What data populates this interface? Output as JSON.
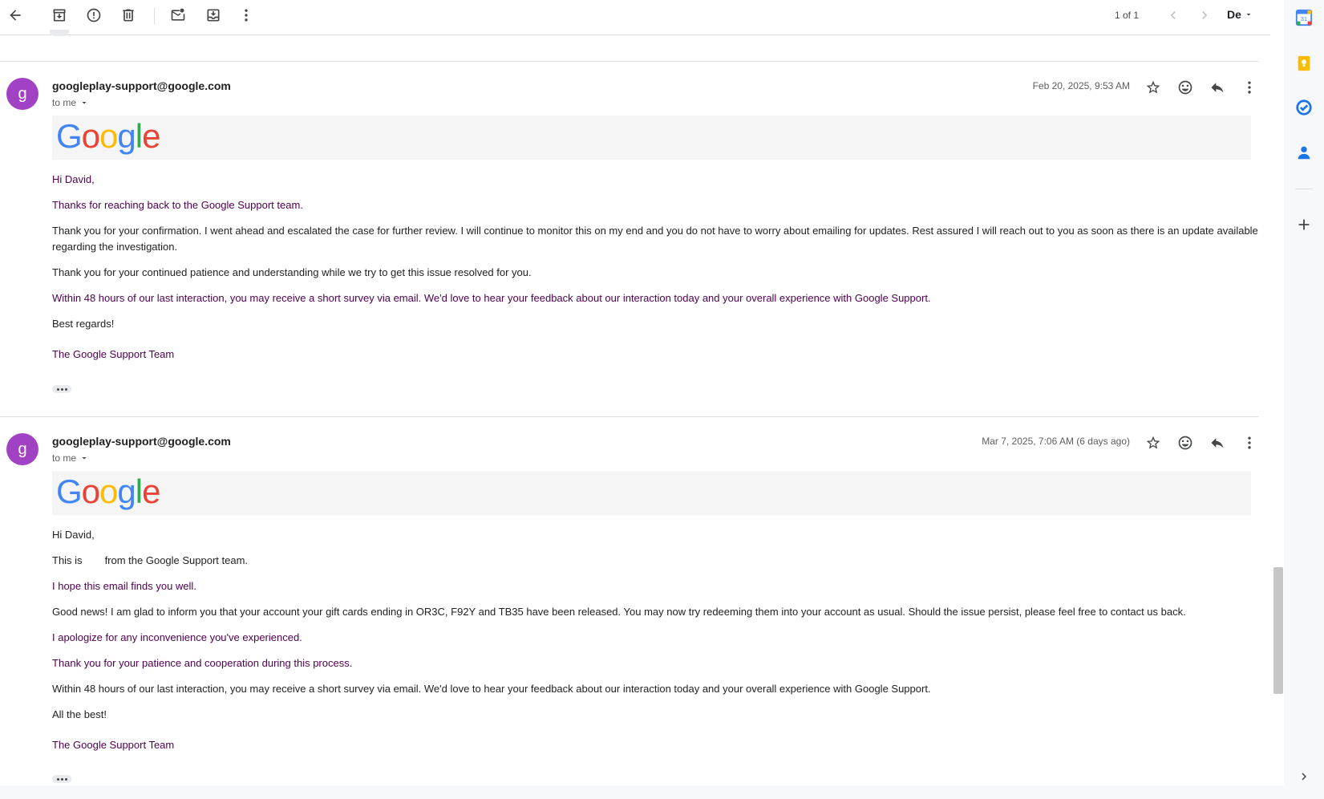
{
  "toolbar": {
    "icons": [
      "back-arrow-icon",
      "archive-icon",
      "report-spam-icon",
      "delete-icon",
      "mark-unread-icon",
      "move-to-icon",
      "more-vert-icon"
    ],
    "pager": "1 of 1",
    "language": "De"
  },
  "messages": [
    {
      "avatar_letter": "g",
      "avatar_color": "#a142c4",
      "sender": "googleplay-support@google.com",
      "to": "to me",
      "date": "Feb 20, 2025, 9:53 AM",
      "logo_text": "Google",
      "paragraphs": [
        {
          "text": "Hi David,",
          "purple": true
        },
        {
          "text": "Thanks for reaching back to the Google Support team.",
          "purple": true
        },
        {
          "text": "Thank you for your confirmation. I went ahead and escalated the case for further review. I will continue to monitor this on my end and you do not have to worry about emailing for updates. Rest assured I will reach out to you as soon as there is an update available regarding the investigation.",
          "purple": false
        },
        {
          "text": "Thank you for your continued patience and understanding while we try to get this issue resolved for you.",
          "purple": false
        },
        {
          "text": "Within 48 hours of our last interaction, you may receive a short survey via email. We'd love to hear your feedback about our interaction today and your overall experience with Google Support.",
          "purple": true
        },
        {
          "text": "Best regards!",
          "purple": false
        }
      ],
      "signature": "The Google Support Team"
    },
    {
      "avatar_letter": "g",
      "avatar_color": "#a142c4",
      "sender": "googleplay-support@google.com",
      "to": "to me",
      "date": "Mar 7, 2025, 7:06 AM (6 days ago)",
      "logo_text": "Google",
      "greeting": "Hi David,",
      "intro_before": "This is",
      "intro_after": "from the Google Support team.",
      "p2": "I hope this email finds you well.",
      "p3": "Good news! I am glad to inform you that your account your gift cards ending in OR3C, F92Y and TB35 have been released. You may now try redeeming them into your account as usual. Should the issue persist, please feel free to contact us back.",
      "p4": "I apologize for any inconvenience you've experienced.",
      "p5": "Thank you for your patience and cooperation during this process.",
      "p6": "Within 48 hours of our last interaction, you may receive a short survey via email. We'd love to hear your feedback about our interaction today and your overall experience with Google Support.",
      "p7": "All the best!",
      "signature": "The Google Support Team"
    }
  ],
  "side_panel": {
    "icons": [
      "calendar-icon",
      "keep-icon",
      "tasks-icon",
      "contacts-icon",
      "add-icon",
      "expand-icon"
    ],
    "calendar_day": "31"
  }
}
